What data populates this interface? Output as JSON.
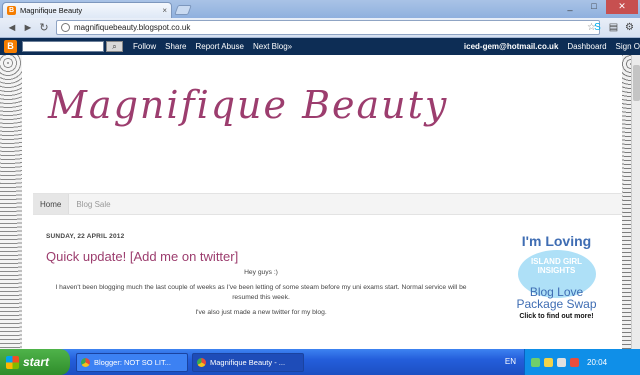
{
  "browser": {
    "tab_title": "Magnifique Beauty",
    "tab_close": "×",
    "url": "magnifiquebeauty.blogspot.co.uk",
    "back": "◄",
    "forward": "►",
    "reload": "↻",
    "bookmark_star": "☆",
    "win_min": "_",
    "win_max": "□",
    "win_close": "✕"
  },
  "navbar": {
    "logo": "B",
    "search_button": "🔍",
    "links": [
      "Follow",
      "Share",
      "Report Abuse",
      "Next Blog»"
    ],
    "email": "iced-gem@hotmail.co.uk",
    "dashboard": "Dashboard",
    "sign_out": "Sign O"
  },
  "blog": {
    "title": "Magnifique Beauty",
    "tabs": [
      "Home",
      "Blog Sale"
    ],
    "post": {
      "date": "SUNDAY, 22 APRIL 2012",
      "title": "Quick update! [Add me on twitter]",
      "paragraphs": [
        "Hey guys :)",
        "I haven't been blogging much the last couple of weeks as I've been letting of some steam before my uni exams start. Normal service will be resumed this week.",
        "I've also just made a new twitter for my blog."
      ]
    },
    "badge": {
      "top": "I'm Loving",
      "circle_lines": [
        "ISLAND GIRL",
        "INSIGHTS"
      ],
      "mid_lines": [
        "Blog Love",
        "Package Swap"
      ],
      "bottom": "Click to find out more!"
    }
  },
  "taskbar": {
    "start": "start",
    "tasks": [
      "Blogger: NOT SO LIT...",
      "Magnifique Beauty - ..."
    ],
    "language": "EN",
    "clock": "20:04"
  },
  "colors": {
    "accent": "#9c3d6e",
    "navbar": "#0d2d55",
    "taskbar": "#245edb"
  }
}
